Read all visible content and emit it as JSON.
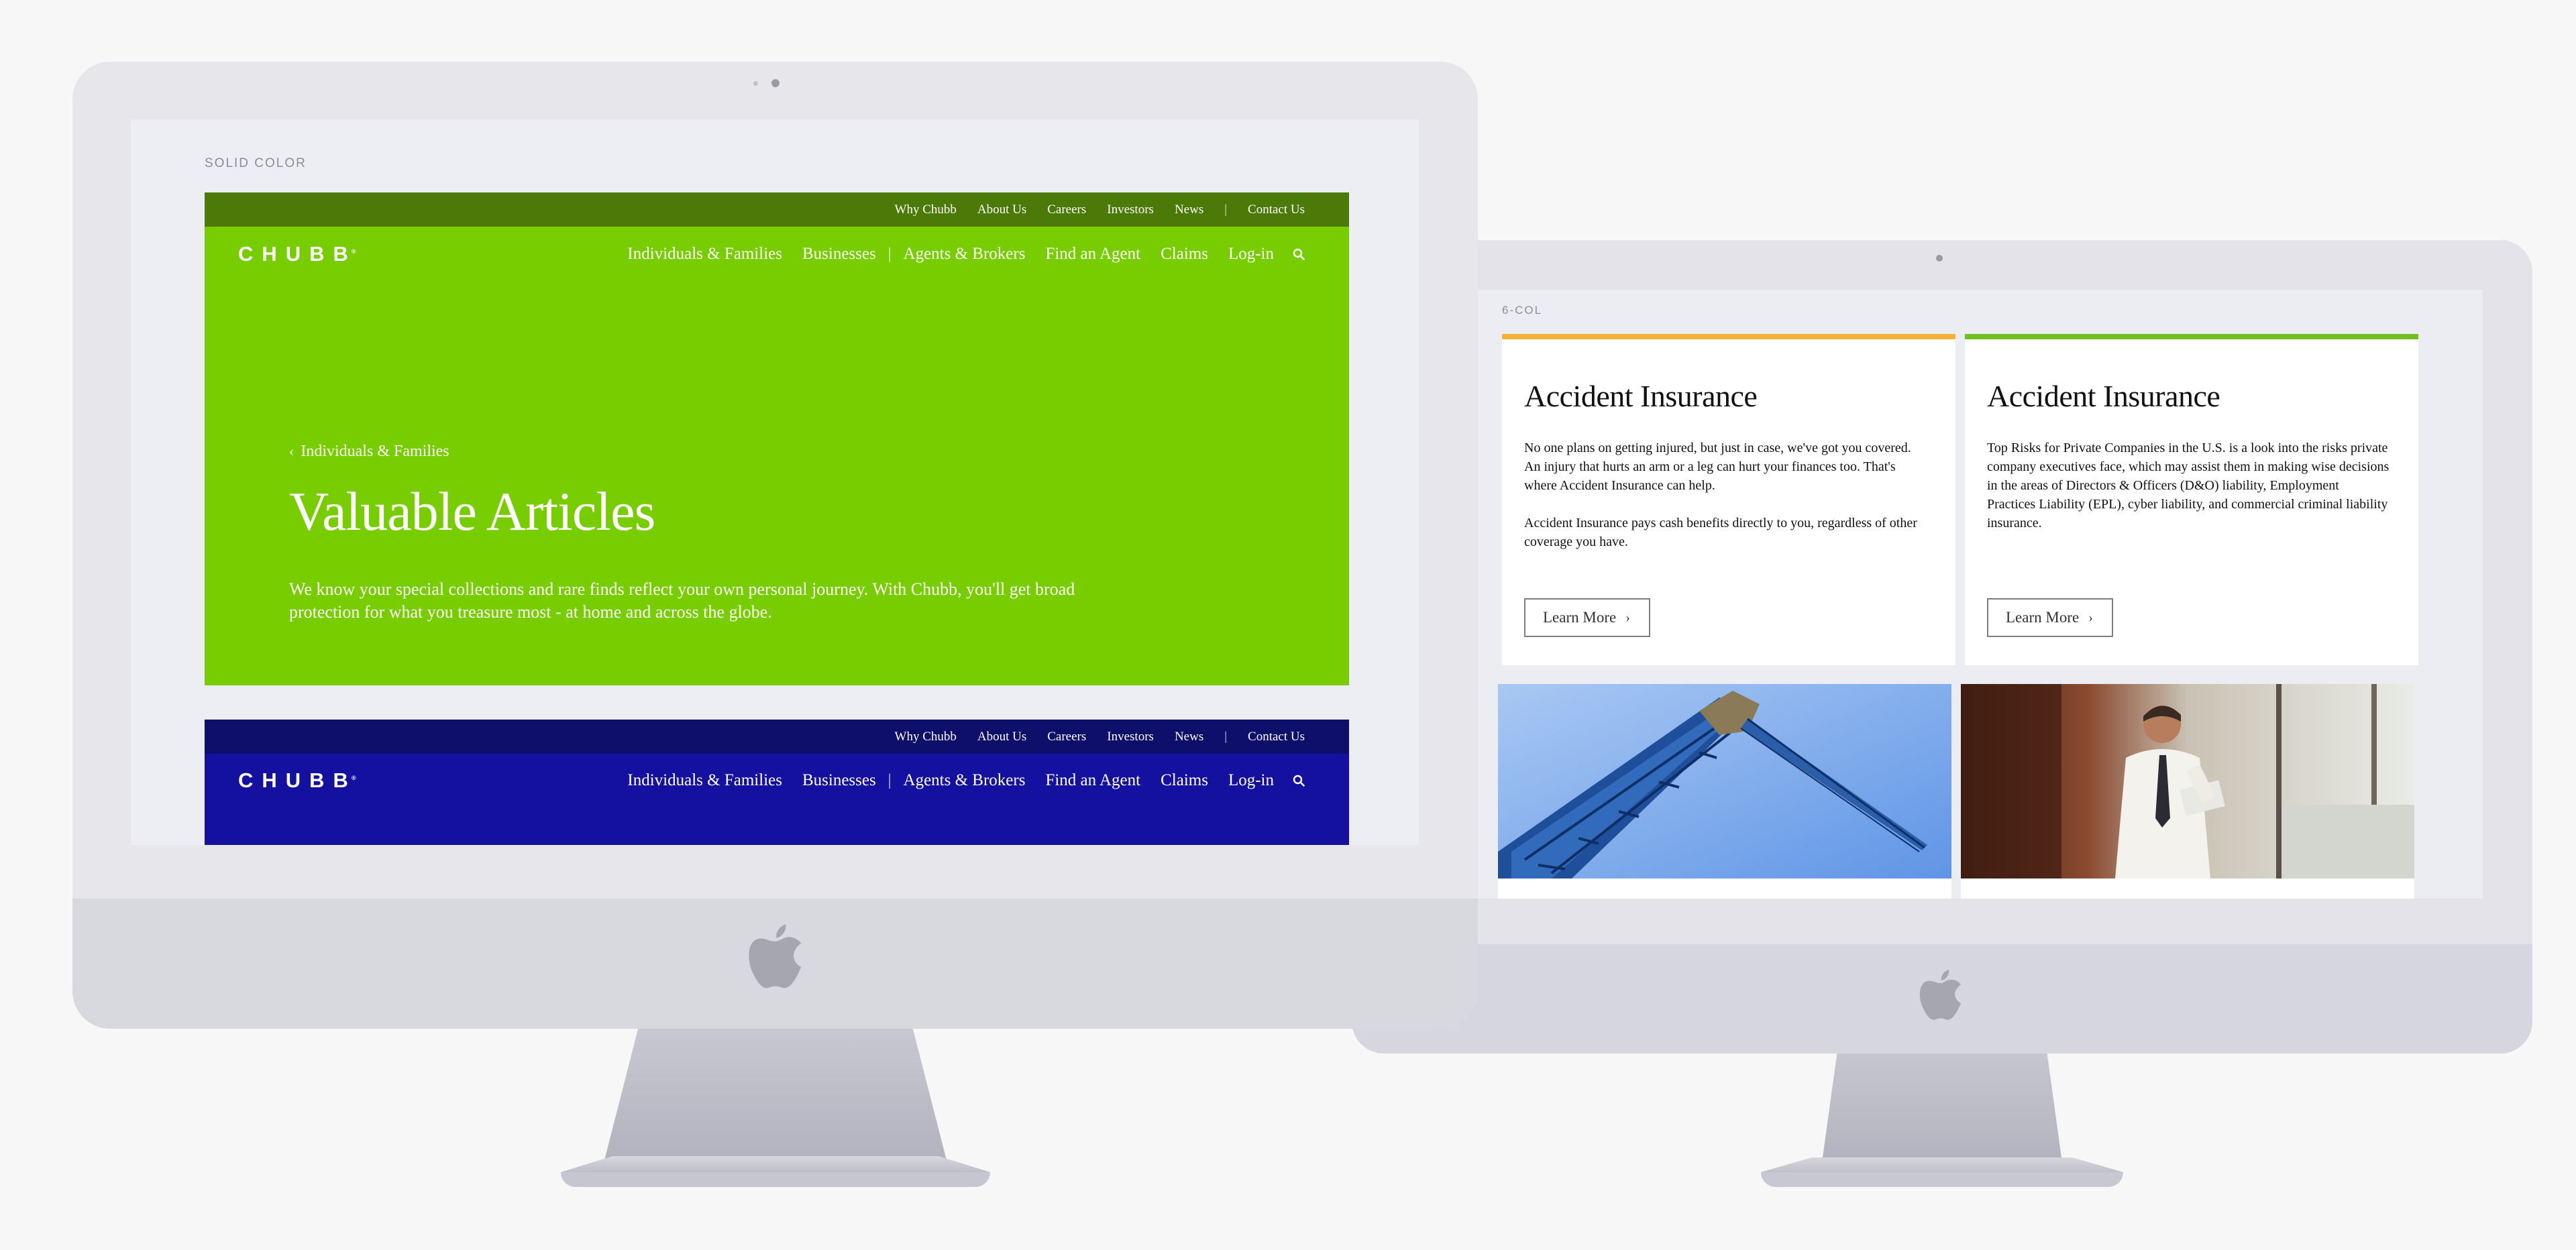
{
  "left_screen": {
    "label": "SOLID COLOR",
    "utility_nav": [
      "Why Chubb",
      "About Us",
      "Careers",
      "Investors",
      "News",
      "|",
      "Contact Us"
    ],
    "logo": "CHUBB",
    "logo_mark": "®",
    "main_nav": [
      "Individuals & Families",
      "Businesses",
      "|",
      "Agents & Brokers",
      "Find an Agent",
      "Claims",
      "Log-in"
    ],
    "hero": {
      "breadcrumb": "Individuals & Families",
      "title": "Valuable Articles",
      "description": "We know your special collections and rare finds reflect your own personal journey. With Chubb, you'll get broad protection for what you treasure most - at home and across the globe."
    },
    "colors": {
      "green_topbar": "#4c7a08",
      "green_main": "#78cd00",
      "blue_topbar": "#0e0e6b",
      "blue_main": "#1410a0"
    }
  },
  "right_screen": {
    "label": "6-COL",
    "cards": [
      {
        "title": "Accident Insurance",
        "accent": "#f5b335",
        "paragraphs": [
          "No one plans on getting injured, but just in case, we've got you covered. An injury that hurts an arm or a leg can hurt your finances too. That's where Accident Insurance can help.",
          "Accident Insurance pays cash benefits directly to you, regardless of other coverage you have."
        ],
        "button": "Learn More"
      },
      {
        "title": "Accident Insurance",
        "accent": "#72c01e",
        "paragraphs": [
          "Top Risks for Private Companies in the U.S. is a look into the risks private company executives face, which may assist them in making wise decisions in the areas of Directors & Officers (D&O) liability, Employment Practices Liability (EPL), cyber liability, and commercial criminal liability insurance."
        ],
        "button": "Learn More"
      }
    ]
  }
}
